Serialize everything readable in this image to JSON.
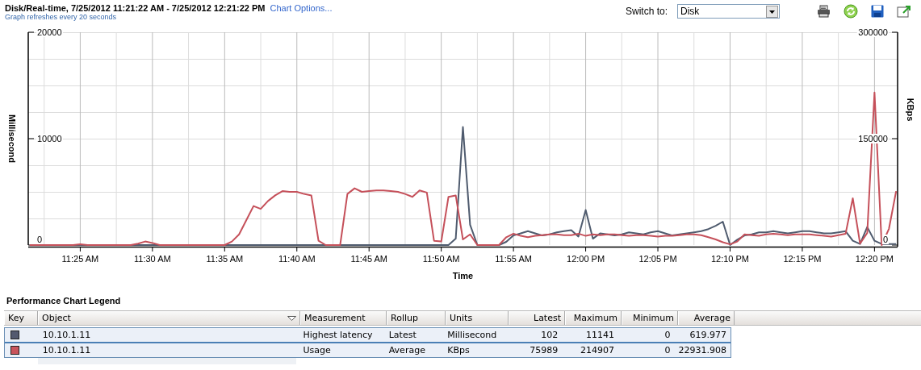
{
  "header": {
    "title": "Disk/Real-time, 7/25/2012 11:21:22 AM - 7/25/2012 12:21:22 PM",
    "chart_options_link": "Chart Options...",
    "refresh_note": "Graph refreshes every 20 seconds"
  },
  "switch_to": {
    "label": "Switch to:",
    "value": "Disk"
  },
  "chart": {
    "chart_data": {
      "type": "line",
      "xlabel": "Time",
      "ylabel": "Millisecond",
      "y2label": "KBps",
      "categories": [
        null,
        null,
        null,
        null,
        null,
        null,
        null,
        "11:25 AM",
        null,
        null,
        null,
        null,
        null,
        null,
        null,
        null,
        null,
        "11:30 AM",
        null,
        null,
        null,
        null,
        null,
        null,
        null,
        null,
        null,
        "11:35 AM",
        null,
        null,
        null,
        null,
        null,
        null,
        null,
        null,
        null,
        "11:40 AM",
        null,
        null,
        null,
        null,
        null,
        null,
        null,
        null,
        null,
        "11:45 AM",
        null,
        null,
        null,
        null,
        null,
        null,
        null,
        null,
        null,
        "11:50 AM",
        null,
        null,
        null,
        null,
        null,
        null,
        null,
        null,
        null,
        "11:55 AM",
        null,
        null,
        null,
        null,
        null,
        null,
        null,
        null,
        null,
        "12:00 PM",
        null,
        null,
        null,
        null,
        null,
        null,
        null,
        null,
        null,
        "12:05 PM",
        null,
        null,
        null,
        null,
        null,
        null,
        null,
        null,
        null,
        "12:10 PM",
        null,
        null,
        null,
        null,
        null,
        null,
        null,
        null,
        null,
        "12:15 PM",
        null,
        null,
        null,
        null,
        null,
        null,
        null,
        null,
        null,
        "12:20 PM",
        null,
        null,
        null
      ],
      "grid": true,
      "ylim": [
        0,
        20000
      ],
      "yticks": [
        0,
        10000,
        20000
      ],
      "y2lim": [
        0,
        300000
      ],
      "y2ticks": [
        0,
        150000,
        300000
      ],
      "series": [
        {
          "color": "#4f5b6e",
          "values": [
            0,
            0,
            0,
            0,
            0,
            0,
            0,
            0,
            0,
            0,
            0,
            0,
            0,
            0,
            0,
            0,
            0,
            0,
            0,
            0,
            0,
            0,
            0,
            0,
            0,
            0,
            0,
            0,
            0,
            0,
            0,
            0,
            0,
            0,
            0,
            0,
            0,
            0,
            0,
            0,
            0,
            0,
            0,
            0,
            0,
            0,
            0,
            0,
            0,
            0,
            0,
            0,
            0,
            0,
            0,
            0,
            0,
            0,
            0,
            600,
            11100,
            1900,
            0,
            0,
            0,
            0,
            300,
            900,
            1100,
            1300,
            1100,
            900,
            1000,
            1200,
            1300,
            1400,
            800,
            3300,
            600,
            1100,
            1000,
            900,
            1000,
            1200,
            1100,
            1000,
            1200,
            1300,
            1100,
            900,
            1000,
            1100,
            1200,
            1300,
            1500,
            1800,
            2200,
            0,
            500,
            900,
            1000,
            1200,
            1200,
            1300,
            1200,
            1100,
            1200,
            1300,
            1300,
            1200,
            1100,
            1100,
            1200,
            1300,
            400,
            100,
            1700,
            400,
            100,
            100,
            100
          ]
        },
        {
          "color": "#c5505a",
          "axis": "y2",
          "values": [
            0,
            0,
            0,
            0,
            0,
            0,
            0,
            1000,
            0,
            0,
            0,
            0,
            0,
            0,
            0,
            2000,
            5000,
            3000,
            0,
            0,
            0,
            0,
            0,
            0,
            0,
            0,
            0,
            0,
            5000,
            15000,
            35000,
            55000,
            51000,
            62000,
            70000,
            76000,
            75000,
            75000,
            72000,
            70000,
            6000,
            0,
            0,
            0,
            72000,
            80000,
            75000,
            76000,
            77000,
            77000,
            76000,
            75000,
            72000,
            68000,
            77000,
            74000,
            6000,
            5000,
            68000,
            70000,
            8000,
            15000,
            0,
            0,
            0,
            0,
            11000,
            16000,
            13000,
            11000,
            13000,
            14000,
            15000,
            15000,
            14000,
            14000,
            16000,
            13000,
            15000,
            14000,
            15000,
            15000,
            14000,
            13000,
            14000,
            14000,
            13000,
            12000,
            13000,
            13000,
            14000,
            15000,
            15000,
            14000,
            11000,
            8000,
            4000,
            1000,
            5000,
            15000,
            14000,
            13000,
            15000,
            16000,
            15000,
            14000,
            15000,
            15000,
            15000,
            14000,
            13000,
            12000,
            14000,
            16000,
            66000,
            2000,
            17000,
            215000,
            0,
            23000,
            76000
          ]
        }
      ]
    }
  },
  "legend": {
    "title": "Performance Chart Legend",
    "columns": [
      {
        "label": "Key",
        "sorted": false
      },
      {
        "label": "Object",
        "sorted": true
      },
      {
        "label": "Measurement",
        "sorted": false
      },
      {
        "label": "Rollup",
        "sorted": false
      },
      {
        "label": "Units",
        "sorted": false
      },
      {
        "label": "Latest",
        "sorted": false
      },
      {
        "label": "Maximum",
        "sorted": false
      },
      {
        "label": "Minimum",
        "sorted": false
      },
      {
        "label": "Average",
        "sorted": false
      }
    ],
    "rows": [
      {
        "color": "#545a6f",
        "cells": [
          "",
          "10.10.1.11",
          "Highest latency",
          "Latest",
          "Millisecond",
          "102",
          "11141",
          "0",
          "619.977"
        ]
      },
      {
        "color": "#c8545c",
        "cells": [
          "",
          "10.10.1.11",
          "Usage",
          "Average",
          "KBps",
          "75989",
          "214907",
          "0",
          "22931.908"
        ]
      }
    ]
  }
}
